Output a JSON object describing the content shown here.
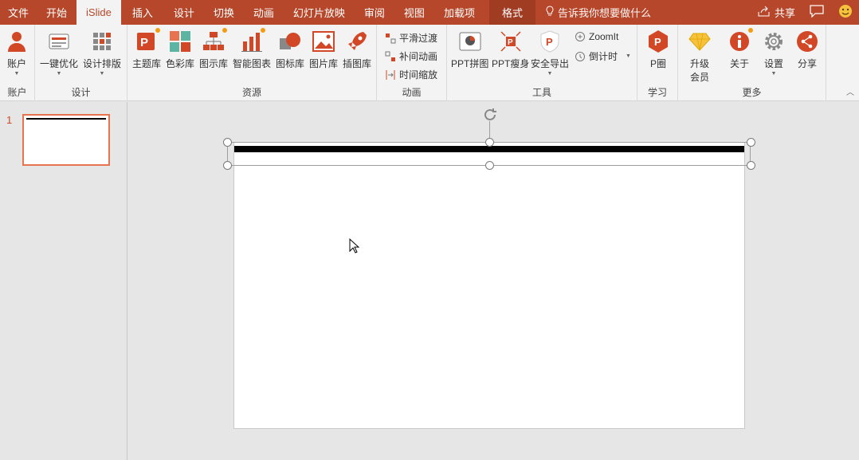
{
  "tabs": [
    "文件",
    "开始",
    "iSlide",
    "插入",
    "设计",
    "切换",
    "动画",
    "幻灯片放映",
    "审阅",
    "视图",
    "加载项",
    "格式"
  ],
  "active_tab": "iSlide",
  "tell_me": "告诉我你想要做什么",
  "share_label": "共享",
  "ribbon": {
    "account": {
      "label": "账户",
      "group": "账户"
    },
    "design": {
      "group": "设计",
      "one_click": "一键优化",
      "layout": "设计排版"
    },
    "resources": {
      "group": "资源",
      "items": [
        "主题库",
        "色彩库",
        "图示库",
        "智能图表",
        "图标库",
        "图片库",
        "插图库"
      ]
    },
    "animation": {
      "group": "动画",
      "items": [
        "平滑过渡",
        "补间动画",
        "时间缩放"
      ]
    },
    "tools": {
      "group": "工具",
      "items": [
        "PPT拼图",
        "PPT瘦身",
        "安全导出"
      ],
      "zoomit": "ZoomIt",
      "countdown": "倒计时"
    },
    "learn": {
      "group": "学习",
      "label": "P圈"
    },
    "more": {
      "group": "更多",
      "upgrade": "升级\n会员",
      "upgrade_line1": "升级",
      "upgrade_line2": "会员",
      "about": "关于",
      "settings": "设置",
      "share": "分享"
    }
  },
  "slides": [
    {
      "number": "1"
    }
  ],
  "colors": {
    "brand": "#b7472a",
    "accent_orange": "#f39c12",
    "thumb_border": "#e8734f"
  }
}
